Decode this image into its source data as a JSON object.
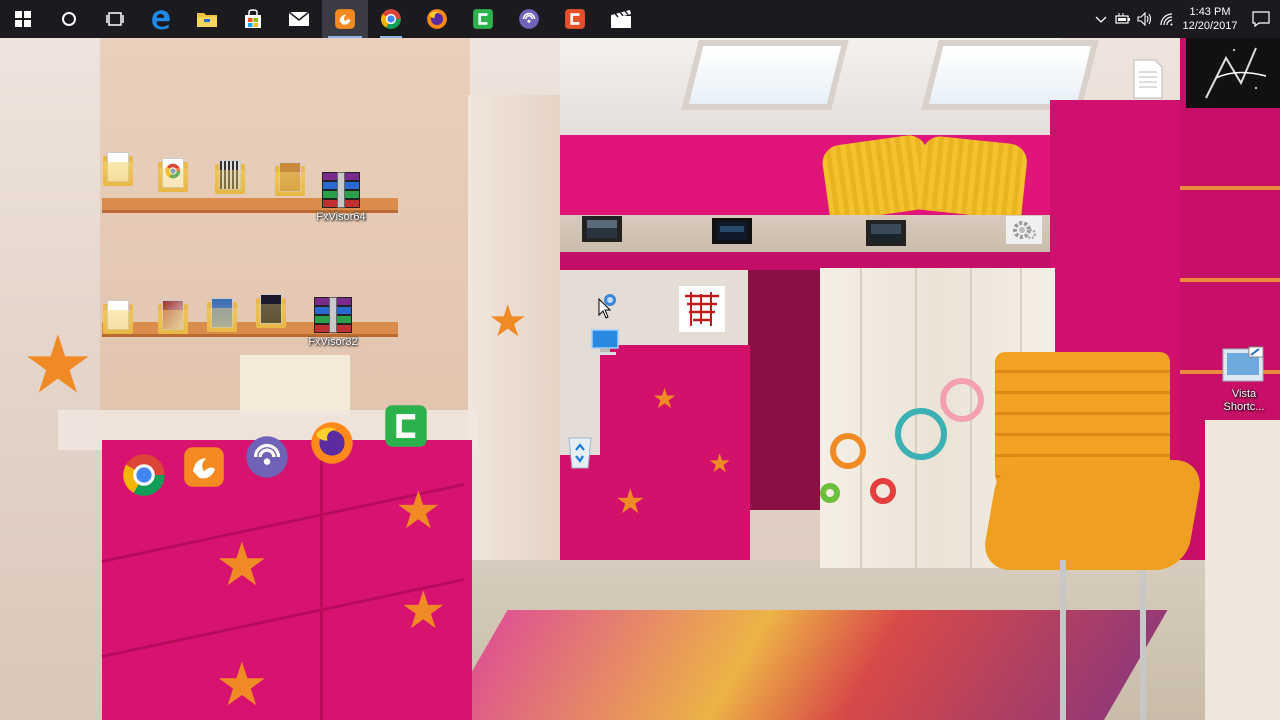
{
  "taskbar": {
    "items": [
      {
        "name": "windows-start-icon"
      },
      {
        "name": "cortana-search-icon"
      },
      {
        "name": "task-view-icon"
      },
      {
        "name": "edge-browser-icon"
      },
      {
        "name": "file-explorer-icon"
      },
      {
        "name": "microsoft-store-icon"
      },
      {
        "name": "mail-icon"
      },
      {
        "name": "uc-browser-icon"
      },
      {
        "name": "chrome-icon"
      },
      {
        "name": "firefox-icon"
      },
      {
        "name": "camtasia-icon"
      },
      {
        "name": "bittorrent-icon"
      },
      {
        "name": "camtasia-recorder-icon"
      },
      {
        "name": "movies-tv-icon"
      }
    ],
    "tray": {
      "time": "1:43 PM",
      "date": "12/20/2017"
    }
  },
  "desktop": {
    "icons": [
      {
        "label": "FxVisor64"
      },
      {
        "label": "FxVisor32"
      },
      {
        "label": "Vista Shortc..."
      }
    ]
  },
  "colors": {
    "taskbar_bg": "#1b1b1f",
    "active_tab_bg": "#3b3b44",
    "accent_underline": "#8fb5e6",
    "wall_pink": "#d8136f"
  }
}
